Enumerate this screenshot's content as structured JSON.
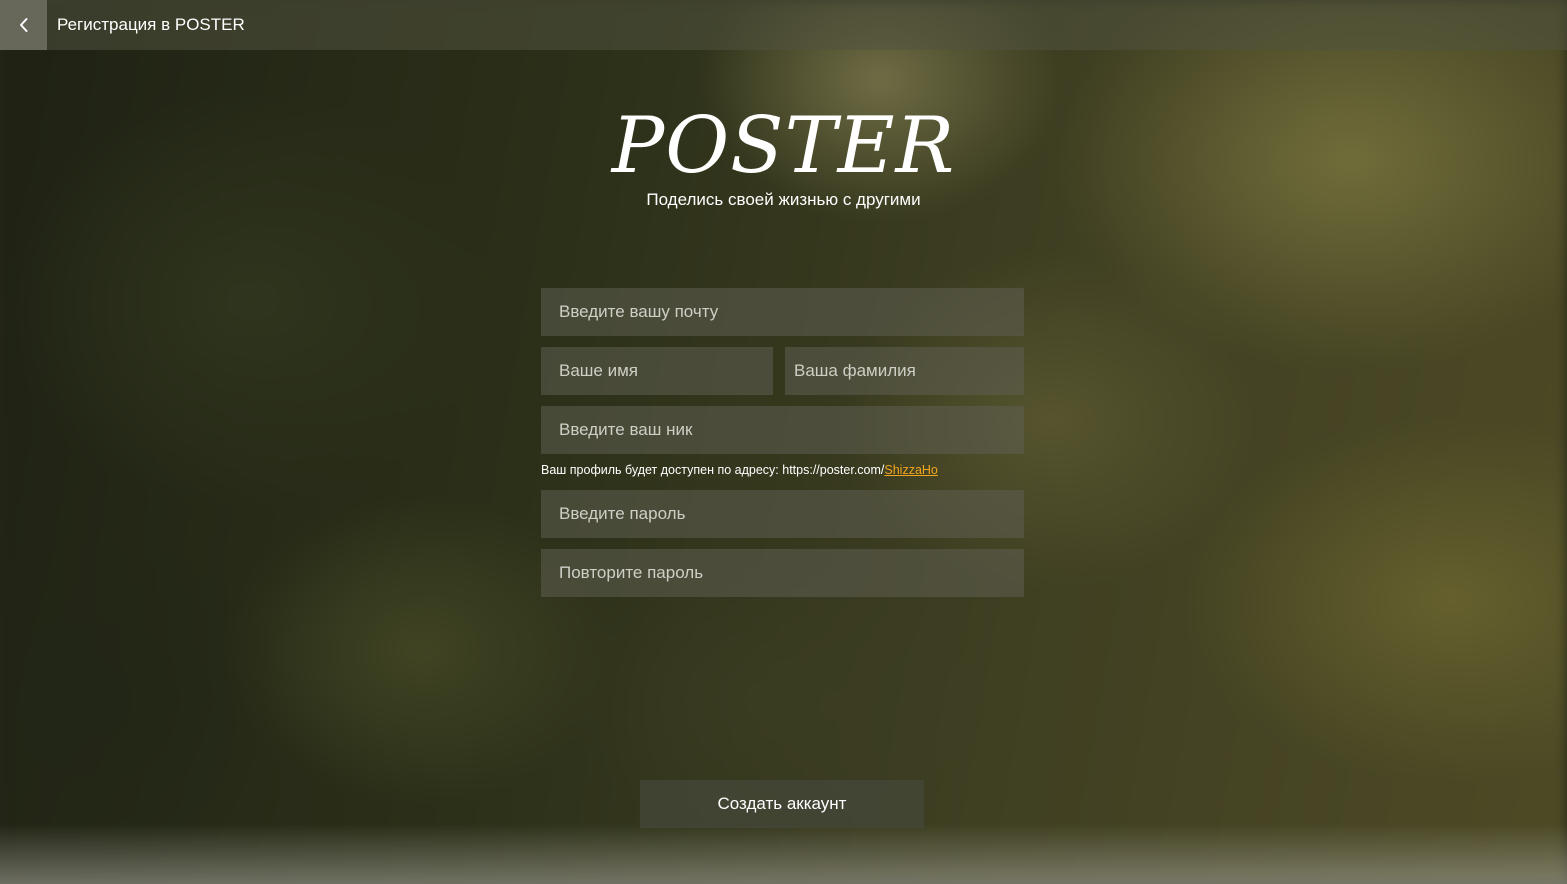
{
  "header": {
    "back_icon": "chevron-left-icon",
    "title": "Регистрация в POSTER"
  },
  "brand": {
    "logo": "POSTER",
    "tagline": "Поделись своей жизнью с другими"
  },
  "form": {
    "email_placeholder": "Введите вашу почту",
    "first_name_placeholder": "Ваше имя",
    "last_name_placeholder": "Ваша фамилия",
    "nick_placeholder": "Введите ваш ник",
    "profile_hint_prefix": "Ваш профиль будет доступен по адресу: https://poster.com/",
    "profile_hint_nick": "ShizzaHo",
    "password_placeholder": "Введите пароль",
    "repeat_password_placeholder": "Повторите пароль",
    "submit_label": "Создать аккаунт"
  },
  "colors": {
    "accent": "#f3a61e",
    "text": "#ffffff"
  }
}
